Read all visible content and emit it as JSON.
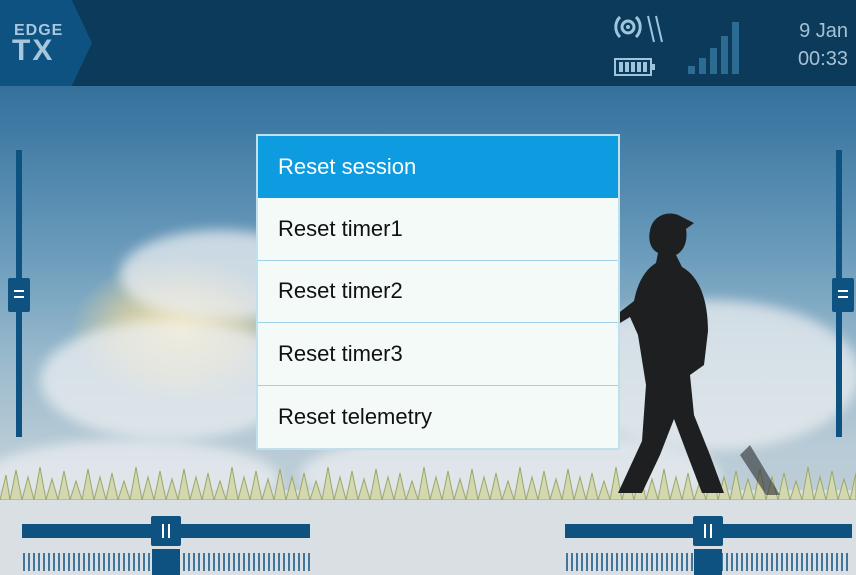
{
  "header": {
    "logo_top": "EDGE",
    "logo_bottom": "TX",
    "date": "9 Jan",
    "time": "00:33",
    "icons": [
      "antenna-icon",
      "battery-icon",
      "signal-strength-icon"
    ]
  },
  "menu": {
    "items": [
      {
        "label": "Reset session",
        "selected": true
      },
      {
        "label": "Reset timer1",
        "selected": false
      },
      {
        "label": "Reset timer2",
        "selected": false
      },
      {
        "label": "Reset timer3",
        "selected": false
      },
      {
        "label": "Reset telemetry",
        "selected": false
      }
    ]
  },
  "trims": {
    "left_vertical": 0.5,
    "right_vertical": 0.5,
    "left_horizontal": 0.5,
    "right_horizontal": 0.5
  },
  "colors": {
    "header_bg": "#0b3a5a",
    "accent": "#0e5282",
    "selected": "#0e9ce0",
    "menu_bg": "#f4faf8"
  }
}
